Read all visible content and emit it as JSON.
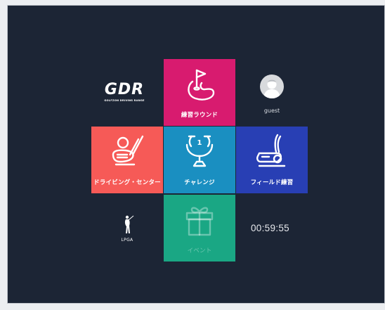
{
  "logo": {
    "main": "GDR",
    "tagline": "GOLFZON DRIVING RANGE"
  },
  "user": {
    "name": "guest"
  },
  "menu": {
    "practice_round": "練習ラウンド",
    "driving_center": "ドライビング・センター",
    "challenge": "チャレンジ",
    "field_practice": "フィールド練習",
    "event": "イベント"
  },
  "sponsor": {
    "name": "LPGA"
  },
  "timer": "00:59:55",
  "icons": {
    "practice_round": "flag-green-icon",
    "driving_center": "driver-club-icon",
    "challenge": "trophy-icon",
    "field_practice": "putter-icon",
    "event": "gift-icon"
  },
  "colors": {
    "background": "#1c2535",
    "practice_round": "#d81b6f",
    "driving_center": "#f65a57",
    "challenge": "#1a8fc1",
    "field_practice": "#283fb4",
    "event": "#1aa784"
  }
}
